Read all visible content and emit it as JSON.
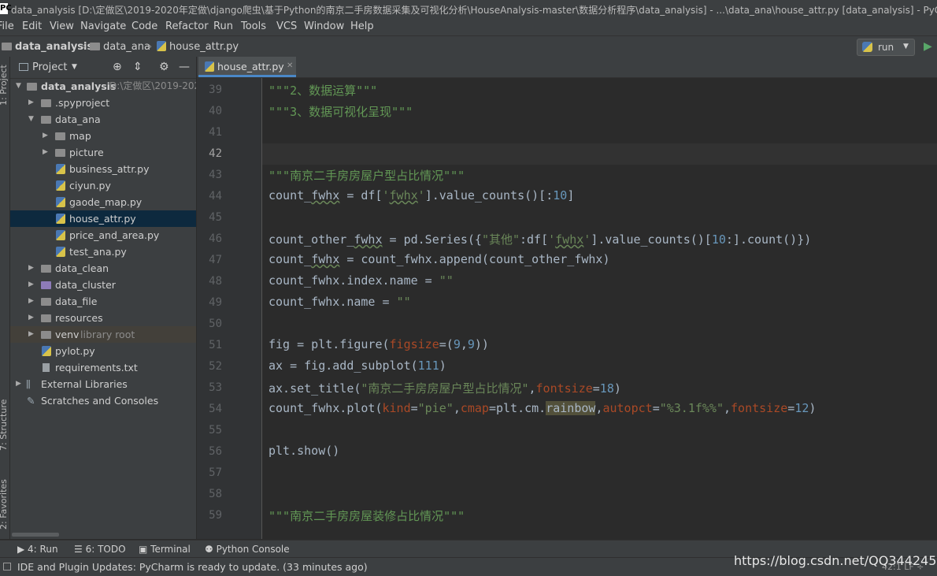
{
  "window": {
    "title": "data_analysis [D:\\定做区\\2019-2020年定做\\django爬虫\\基于Python的南京二手房数据采集及可视化分析\\HouseAnalysis-master\\数据分析程序\\data_analysis] - ...\\data_ana\\house_attr.py [data_analysis] - PyCharm",
    "logo": "PC"
  },
  "menu": [
    "File",
    "Edit",
    "View",
    "Navigate",
    "Code",
    "Refactor",
    "Run",
    "Tools",
    "VCS",
    "Window",
    "Help"
  ],
  "breadcrumb": [
    "data_analysis",
    "data_ana",
    "house_attr.py"
  ],
  "run_config": {
    "label": "run"
  },
  "side_tabs": {
    "project": "1: Project",
    "structure": "7: Structure",
    "favorites": "2: Favorites"
  },
  "project_panel": {
    "title": "Project",
    "tree": [
      {
        "label": "data_analysis",
        "hint": "D:\\定做区\\2019-202",
        "type": "folder",
        "expanded": true
      },
      {
        "label": ".spyproject",
        "type": "folder",
        "expanded": false
      },
      {
        "label": "data_ana",
        "type": "folder",
        "expanded": true
      },
      {
        "label": "map",
        "type": "folder",
        "expanded": false
      },
      {
        "label": "picture",
        "type": "folder",
        "expanded": false
      },
      {
        "label": "business_attr.py",
        "type": "py"
      },
      {
        "label": "ciyun.py",
        "type": "py"
      },
      {
        "label": "gaode_map.py",
        "type": "py"
      },
      {
        "label": "house_attr.py",
        "type": "py",
        "selected": true
      },
      {
        "label": "price_and_area.py",
        "type": "py"
      },
      {
        "label": "test_ana.py",
        "type": "py"
      },
      {
        "label": "data_clean",
        "type": "folder",
        "expanded": false
      },
      {
        "label": "data_cluster",
        "type": "folder",
        "expanded": false
      },
      {
        "label": "data_file",
        "type": "folder",
        "expanded": false
      },
      {
        "label": "resources",
        "type": "folder",
        "expanded": false
      },
      {
        "label": "venv",
        "hint": "library root",
        "type": "folder",
        "expanded": false
      },
      {
        "label": "pylot.py",
        "type": "py"
      },
      {
        "label": "requirements.txt",
        "type": "txt"
      },
      {
        "label": "External Libraries",
        "type": "lib",
        "expanded": false
      },
      {
        "label": "Scratches and Consoles",
        "type": "scratch"
      }
    ]
  },
  "editor": {
    "tab": "house_attr.py",
    "line_numbers": [
      "39",
      "40",
      "41",
      "42",
      "43",
      "44",
      "45",
      "46",
      "47",
      "48",
      "49",
      "50",
      "51",
      "52",
      "53",
      "54",
      "55",
      "56",
      "57",
      "58",
      "59"
    ],
    "current_line": "42",
    "lines": {
      "l39": "\"\"\"2、数据运算\"\"\"",
      "l40": "\"\"\"3、数据可视化呈现\"\"\"",
      "l43": "\"\"\"南京二手房房屋户型占比情况\"\"\"",
      "l44a": "count_",
      "l44b": "fwhx",
      "l44c": " = df[",
      "l44d": "'",
      "l44e": "fwhx",
      "l44f": "'",
      "l44g": "].value_counts()[:",
      "l44h": "10",
      "l44i": "]",
      "l46a": "count_other_",
      "l46b": "fwhx",
      "l46c": " = pd.Series({",
      "l46d": "\"其他\"",
      "l46e": ":df[",
      "l46f": "'",
      "l46g": "fwhx",
      "l46h": "'",
      "l46i": "].value_counts()[",
      "l46j": "10",
      "l46k": ":].count()})",
      "l47a": "count_",
      "l47b": "fwhx",
      "l47c": " = count_fwhx.append(count_other_fwhx)",
      "l48a": "count_fwhx.index.name = ",
      "l48b": "\"\"",
      "l49a": "count_fwhx.name = ",
      "l49b": "\"\"",
      "l51a": "fig = plt.figure(",
      "l51b": "figsize",
      "l51c": "=(",
      "l51d": "9",
      "l51e": ",",
      "l51f": "9",
      "l51g": "))",
      "l52a": "ax = fig.add_subplot(",
      "l52b": "111",
      "l52c": ")",
      "l53a": "ax.set_title(",
      "l53b": "\"南京二手房房屋户型占比情况\"",
      "l53c": ",",
      "l53d": "fontsize",
      "l53e": "=",
      "l53f": "18",
      "l53g": ")",
      "l54a": "count_fwhx.plot(",
      "l54b": "kind",
      "l54c": "=",
      "l54d": "\"pie\"",
      "l54e": ",",
      "l54f": "cmap",
      "l54g": "=plt.cm.",
      "l54h": "rainbow",
      "l54i": ",",
      "l54j": "autopct",
      "l54k": "=",
      "l54l": "\"%3.1f%%\"",
      "l54m": ",",
      "l54n": "fontsize",
      "l54o": "=",
      "l54p": "12",
      "l54q": ")",
      "l56": "plt.show()",
      "l59": "\"\"\"南京二手房房屋装修占比情况\"\"\""
    }
  },
  "tool_windows": [
    "4: Run",
    "6: TODO",
    "Terminal",
    "Python Console"
  ],
  "status": {
    "message": "IDE and Plugin Updates: PyCharm is ready to update. (33 minutes ago)",
    "position": "42:1  LF ÷"
  },
  "watermark": "https://blog.csdn.net/QQ344245001"
}
